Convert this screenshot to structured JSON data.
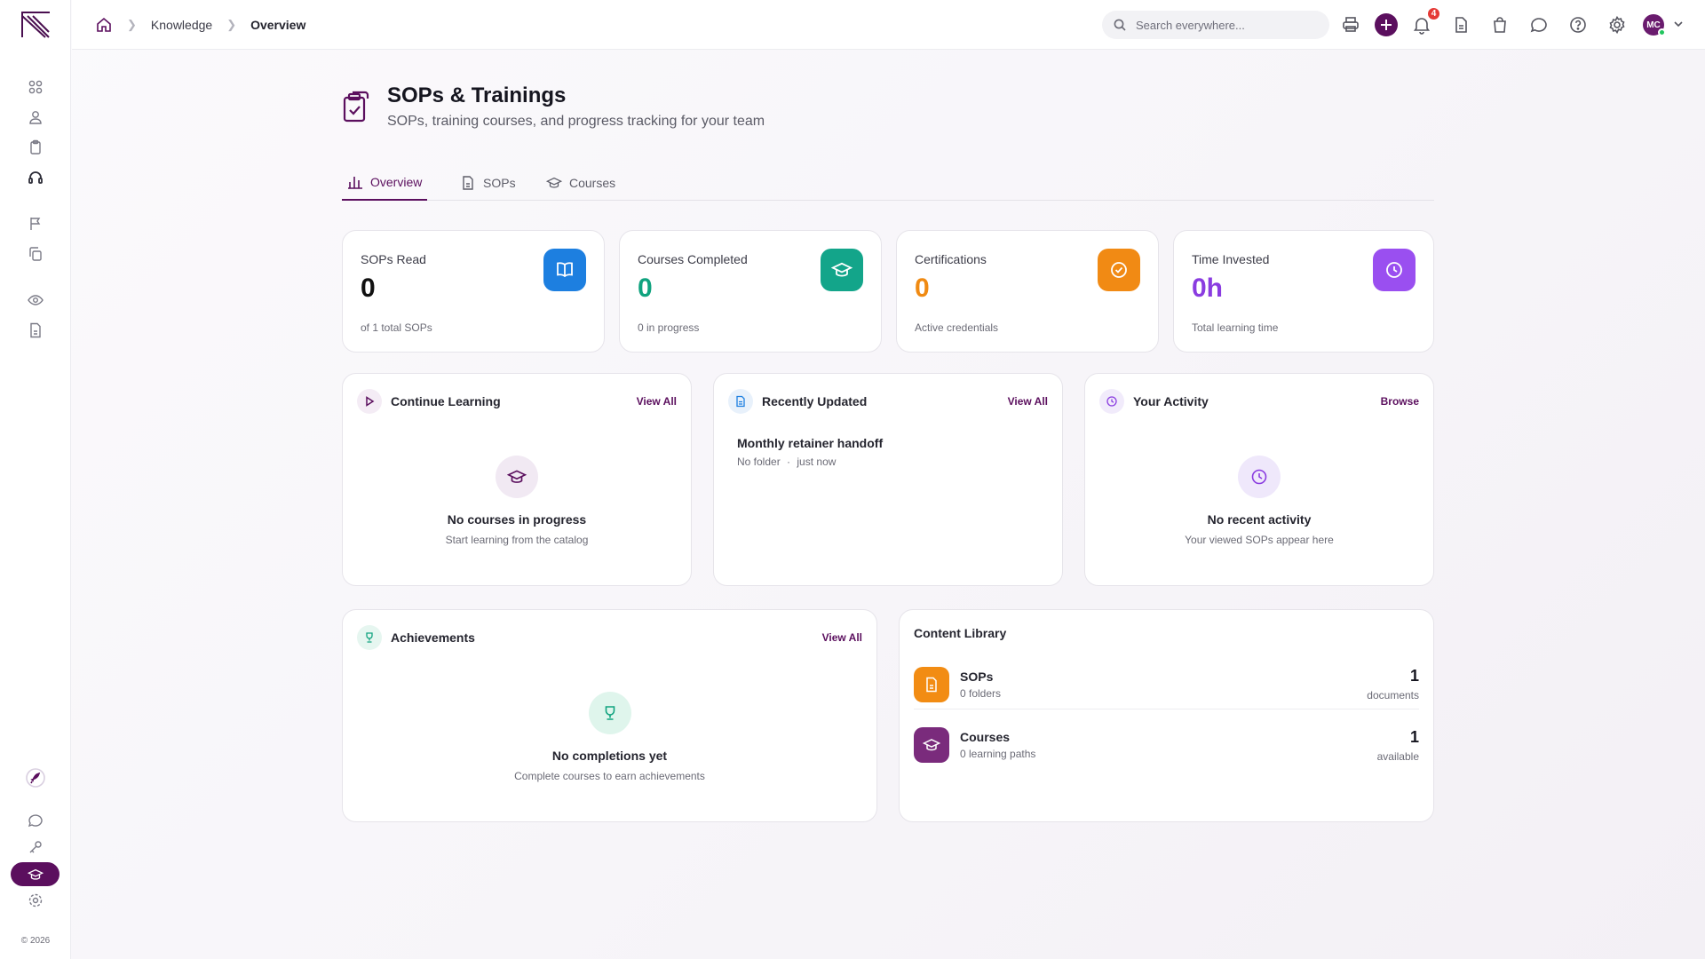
{
  "sidebar": {
    "copyright": "© 2026",
    "items": [
      {
        "icon": "apps-icon"
      },
      {
        "icon": "user-icon"
      },
      {
        "icon": "clipboard-icon"
      },
      {
        "icon": "headset-icon"
      },
      {
        "icon": "flag-icon"
      },
      {
        "icon": "copy-icon"
      },
      {
        "icon": "eye-icon"
      },
      {
        "icon": "document-icon"
      },
      {
        "icon": "rocket-icon"
      },
      {
        "icon": "chat-icon"
      },
      {
        "icon": "key-icon"
      },
      {
        "icon": "graduation-cap-icon",
        "active": true
      },
      {
        "icon": "settings-icon"
      }
    ]
  },
  "header": {
    "breadcrumb": [
      "Knowledge",
      "Overview"
    ],
    "search_placeholder": "Search everywhere...",
    "notification_count": "4",
    "avatar_initials": "MC"
  },
  "page": {
    "title": "SOPs & Trainings",
    "subtitle": "SOPs, training courses, and progress tracking for your team"
  },
  "tabs": [
    {
      "label": "Overview",
      "active": true
    },
    {
      "label": "SOPs",
      "active": false
    },
    {
      "label": "Courses",
      "active": false
    }
  ],
  "stats": [
    {
      "label": "SOPs Read",
      "value": "0",
      "note": "of 1 total SOPs",
      "color": "#111111",
      "icon_bg": "#1d7fe0"
    },
    {
      "label": "Courses Completed",
      "value": "0",
      "note": "0 in progress",
      "color": "#10a37f",
      "icon_bg": "#13a58a"
    },
    {
      "label": "Certifications",
      "value": "0",
      "note": "Active credentials",
      "color": "#f08a12",
      "icon_bg": "#f18a14"
    },
    {
      "label": "Time Invested",
      "value": "0h",
      "note": "Total learning time",
      "color": "#8a3ce0",
      "icon_bg": "#9a4ff0"
    }
  ],
  "continue_learning": {
    "title": "Continue Learning",
    "link": "View All",
    "empty_title": "No courses in progress",
    "empty_sub": "Start learning from the catalog"
  },
  "recently_updated": {
    "title": "Recently Updated",
    "link": "View All",
    "items": [
      {
        "title": "Monthly retainer handoff",
        "folder": "No folder",
        "time": "just now"
      }
    ]
  },
  "your_activity": {
    "title": "Your Activity",
    "link": "Browse",
    "empty_title": "No recent activity",
    "empty_sub": "Your viewed SOPs appear here"
  },
  "achievements": {
    "title": "Achievements",
    "link": "View All",
    "empty_title": "No completions yet",
    "empty_sub": "Complete courses to earn achievements"
  },
  "content_library": {
    "title": "Content Library",
    "rows": [
      {
        "name": "SOPs",
        "meta": "0 folders",
        "count": "1",
        "unit": "documents",
        "icon_bg": "#f28c13"
      },
      {
        "name": "Courses",
        "meta": "0 learning paths",
        "count": "1",
        "unit": "available",
        "icon_bg": "#7a2b7c"
      }
    ]
  },
  "colors": {
    "brand": "#5b0f5e",
    "badge": "#e53935",
    "online": "#22c55e"
  }
}
